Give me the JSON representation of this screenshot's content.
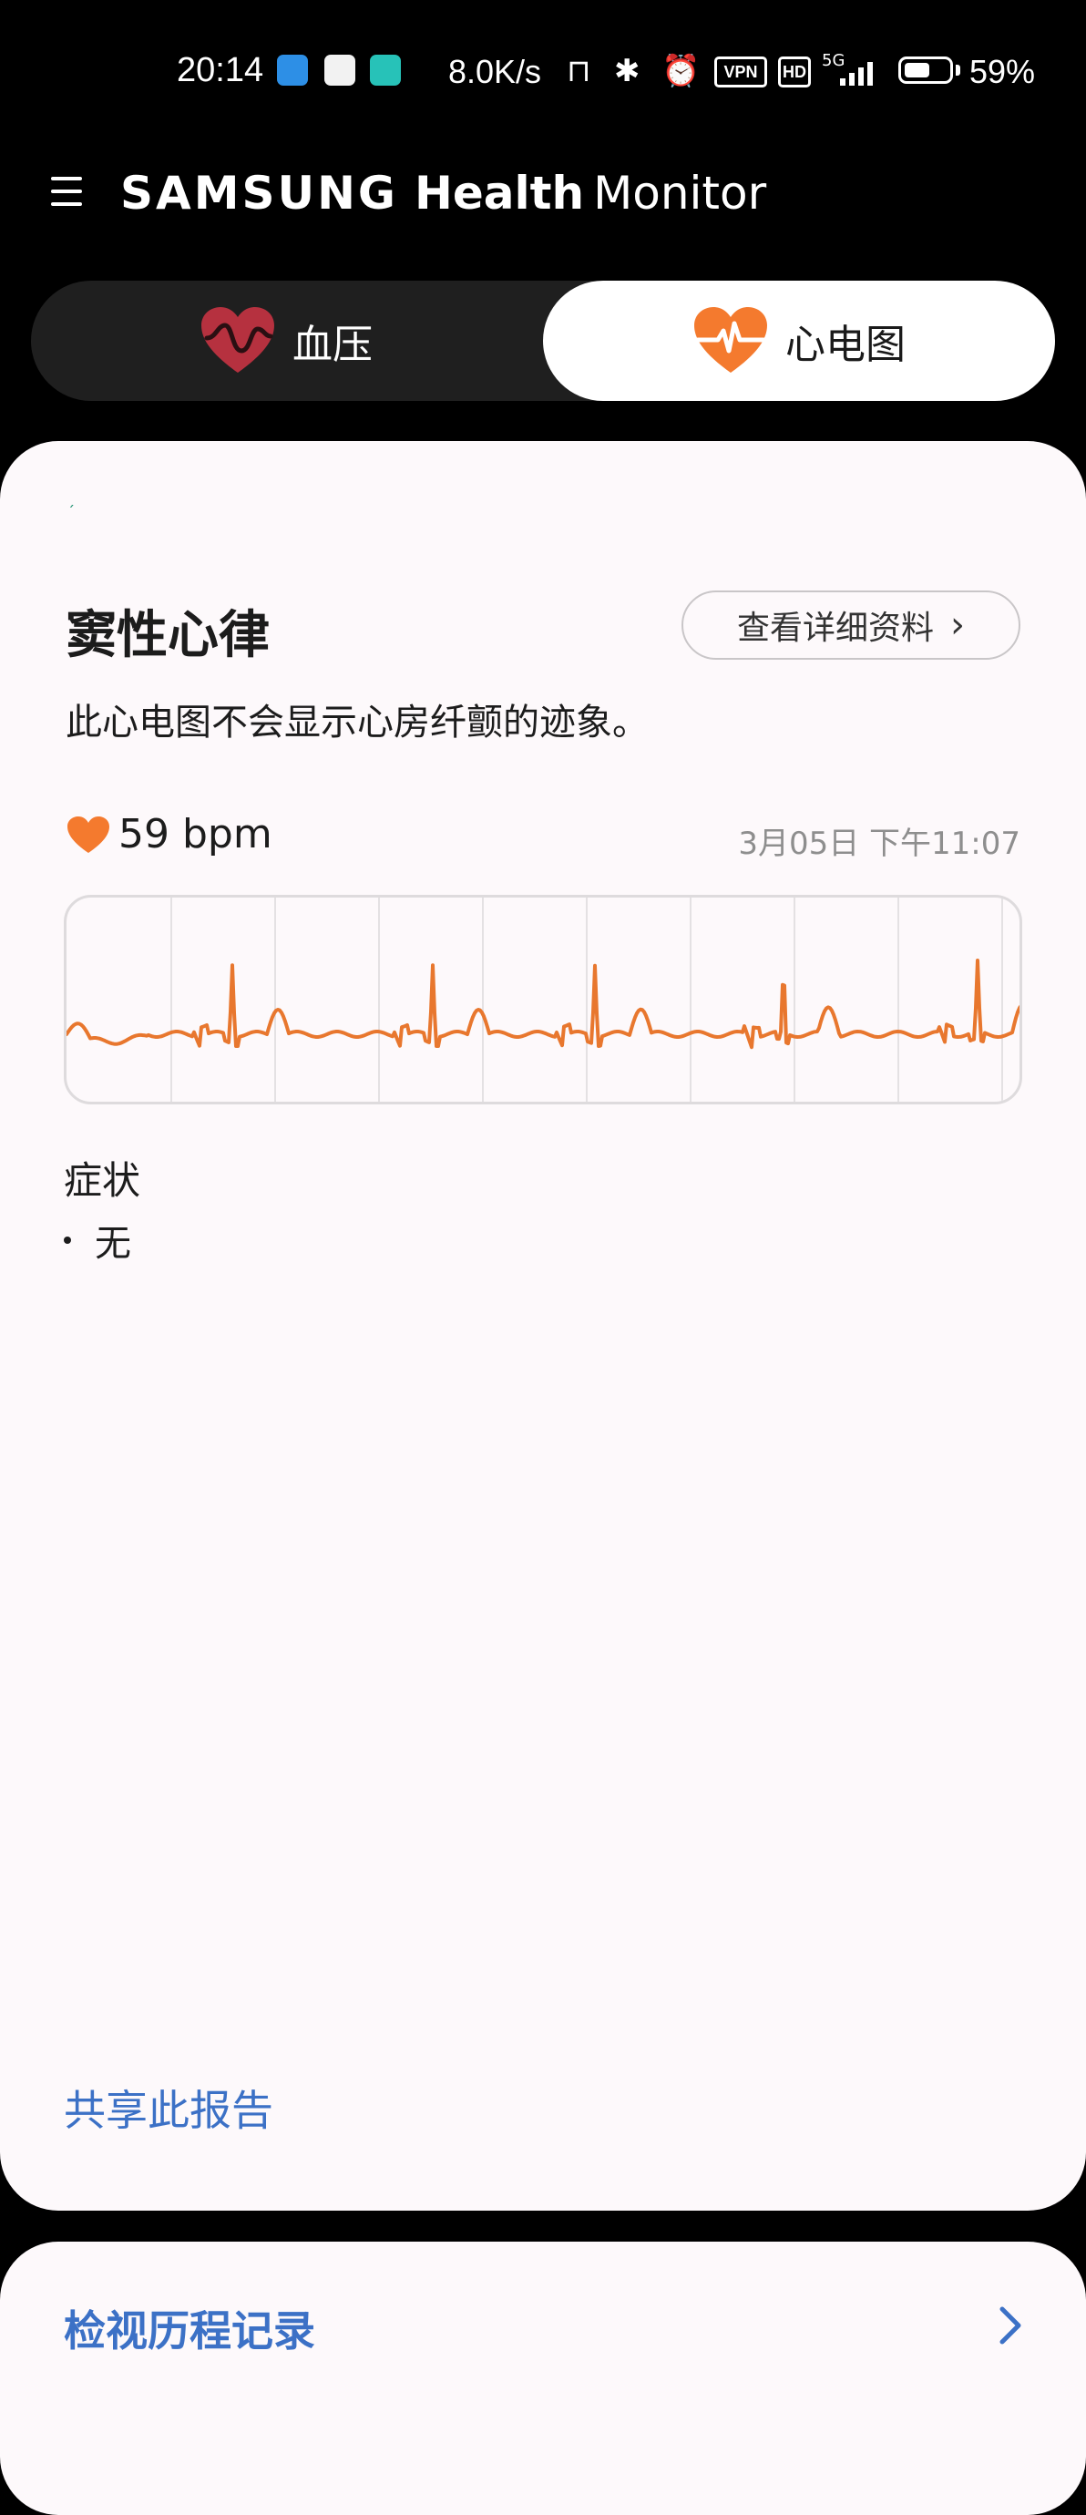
{
  "status_bar": {
    "time": "20:14",
    "net_speed": "8.0K/s",
    "vpn": "VPN",
    "hd": "HD",
    "network": "5G",
    "battery_level": 0.59,
    "battery_percent": "59%"
  },
  "header": {
    "brand": "SAMSUNG",
    "health": "Health",
    "monitor": "Monitor",
    "menu_icon": "hamburger-menu-icon"
  },
  "tabs": [
    {
      "label": "血压",
      "icon": "blood-pressure-heart-icon",
      "selected": false
    },
    {
      "label": "心电图",
      "icon": "ecg-heart-icon",
      "selected": true
    }
  ],
  "result": {
    "title": "窦性心律",
    "details_button": "查看详细资料",
    "description": "此心电图不会显示心房纤颤的迹象。",
    "bpm": "59 bpm",
    "timestamp": "3月05日 下午11:07"
  },
  "symptoms": {
    "label": "症状",
    "items": [
      "无"
    ]
  },
  "actions": {
    "share": "共享此报告",
    "history": "检视历程记录"
  },
  "colors": {
    "accent_orange": "#f47a2e",
    "bp_red": "#b6313f",
    "link_blue": "#3c71c6",
    "card_bg": "#fdf9fb"
  }
}
